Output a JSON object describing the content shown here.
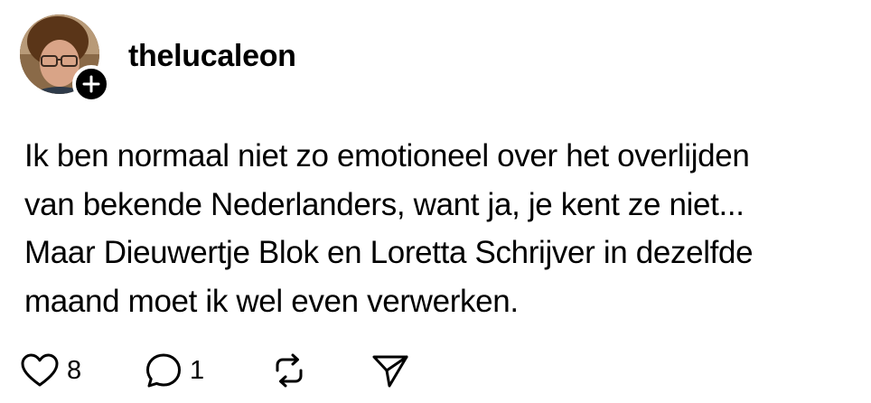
{
  "post": {
    "username": "thelucaleon",
    "text_lines": [
      "Ik ben normaal niet zo emotioneel over het overlijden",
      "van bekende Nederlanders, want ja, je kent ze niet...",
      "Maar Dieuwertje Blok en Loretta Schrijver in dezelfde",
      "maand moet ik wel even verwerken."
    ],
    "likes": "8",
    "replies": "1"
  },
  "icons": {
    "follow": "plus-icon",
    "like": "heart-icon",
    "reply": "speech-bubble-icon",
    "repost": "repost-arrows-icon",
    "share": "paper-plane-icon"
  },
  "colors": {
    "text": "#000000",
    "background": "#ffffff",
    "badge": "#000000"
  }
}
